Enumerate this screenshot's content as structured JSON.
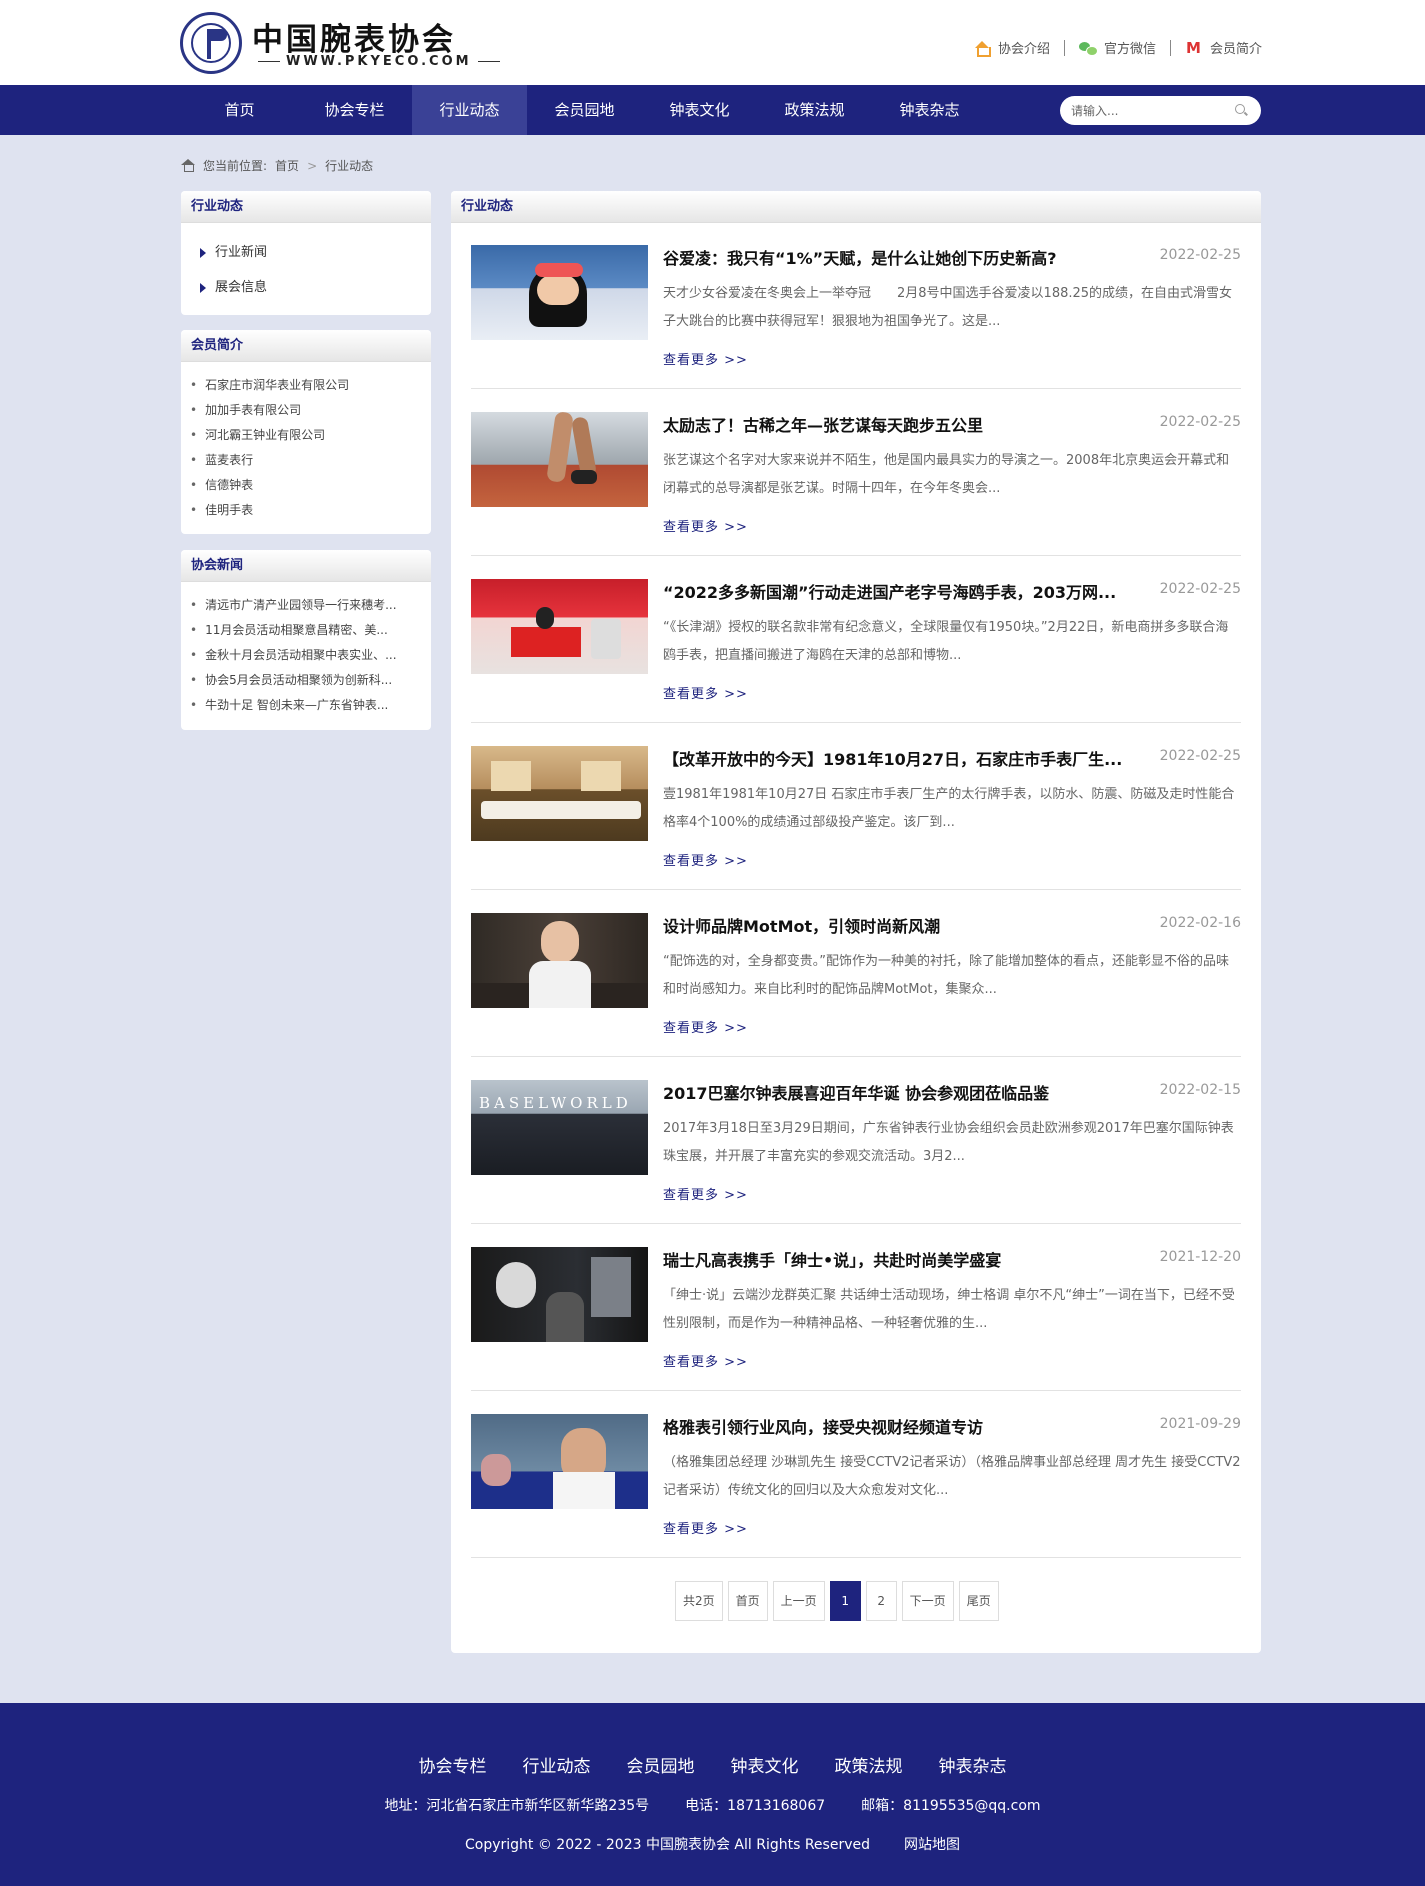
{
  "header": {
    "logo_title": "中国腕表协会",
    "logo_url": "WWW.PKYECO.COM",
    "links": [
      {
        "label": "协会介绍",
        "icon": "home-icon"
      },
      {
        "label": "官方微信",
        "icon": "wechat-icon"
      },
      {
        "label": "会员简介",
        "icon": "mail-icon"
      }
    ]
  },
  "nav": {
    "items": [
      "首页",
      "协会专栏",
      "行业动态",
      "会员园地",
      "钟表文化",
      "政策法规",
      "钟表杂志"
    ],
    "active": "行业动态",
    "search_placeholder": "请输入..."
  },
  "breadcrumb": {
    "prefix": "您当前位置:",
    "items": [
      "首页",
      "行业动态"
    ],
    "separator": ">"
  },
  "sidebar": {
    "category_panel": {
      "title": "行业动态",
      "items": [
        "行业新闻",
        "展会信息"
      ]
    },
    "members_panel": {
      "title": "会员简介",
      "items": [
        "石家庄市润华表业有限公司",
        "加加手表有限公司",
        "河北霸王钟业有限公司",
        "蓝麦表行",
        "信德钟表",
        "佳明手表"
      ]
    },
    "news_panel": {
      "title": "协会新闻",
      "items": [
        "清远市广清产业园领导一行来穗考...",
        "11月会员活动相聚意昌精密、美...",
        "金秋十月会员活动相聚中表实业、...",
        "协会5月会员活动相聚领为创新科...",
        "牛劲十足 智创未来—广东省钟表..."
      ]
    }
  },
  "main": {
    "panel_title": "行业动态",
    "more_label": "查看更多 >>",
    "articles": [
      {
        "title": "谷爱凌：我只有“1%”天赋，是什么让她创下历史新高?",
        "date": "2022-02-25",
        "summary": "天才少女谷爱凌在冬奥会上一举夺冠　　2月8号中国选手谷爱凌以188.25的成绩，在自由式滑雪女子大跳台的比赛中获得冠军！狠狠地为祖国争光了。这是..."
      },
      {
        "title": "太励志了！古稀之年—张艺谋每天跑步五公里",
        "date": "2022-02-25",
        "summary": "张艺谋这个名字对大家来说并不陌生，他是国内最具实力的导演之一。2008年北京奥运会开幕式和闭幕式的总导演都是张艺谋。时隔十四年，在今年冬奥会..."
      },
      {
        "title": "“2022多多新国潮”行动走进国产老字号海鸥手表，203万网...",
        "date": "2022-02-25",
        "summary": "“《长津湖》授权的联名款非常有纪念意义，全球限量仅有1950块。”2月22日，新电商拼多多联合海鸥手表，把直播间搬进了海鸥在天津的总部和博物..."
      },
      {
        "title": "【改革开放中的今天】1981年10月27日，石家庄市手表厂生...",
        "date": "2022-02-25",
        "summary": "壹1981年1981年10月27日 石家庄市手表厂生产的太行牌手表，以防水、防震、防磁及走时性能合格率4个100%的成绩通过部级投产鉴定。该厂到..."
      },
      {
        "title": "设计师品牌MotMot，引领时尚新风潮",
        "date": "2022-02-16",
        "summary": "“配饰选的对，全身都变贵。”配饰作为一种美的衬托，除了能增加整体的看点，还能彰显不俗的品味和时尚感知力。来自比利时的配饰品牌MotMot，集聚众..."
      },
      {
        "title": "2017巴塞尔钟表展喜迎百年华诞 协会参观团莅临品鉴",
        "date": "2022-02-15",
        "summary": "2017年3月18日至3月29日期间，广东省钟表行业协会组织会员赴欧洲参观2017年巴塞尔国际钟表珠宝展，并开展了丰富充实的参观交流活动。3月2..."
      },
      {
        "title": "瑞士凡高表携手「绅士•说」，共赴时尚美学盛宴",
        "date": "2021-12-20",
        "summary": "「绅士·说」云端沙龙群英汇聚 共话绅士活动现场，绅士格调 卓尔不凡“绅士”一词在当下，已经不受性别限制，而是作为一种精神品格、一种轻奢优雅的生..."
      },
      {
        "title": "格雅表引领行业风向，接受央视财经频道专访",
        "date": "2021-09-29",
        "summary": "（格雅集团总经理 沙琳凯先生 接受CCTV2记者采访）（格雅品牌事业部总经理 周才先生 接受CCTV2记者采访）传统文化的回归以及大众愈发对文化..."
      }
    ],
    "thumb_texts": {
      "baselworld": "BASELWORLD"
    }
  },
  "pagination": {
    "total": "共2页",
    "first": "首页",
    "prev": "上一页",
    "pages": [
      "1",
      "2"
    ],
    "current": "1",
    "next": "下一页",
    "last": "尾页"
  },
  "footer": {
    "nav": [
      "协会专栏",
      "行业动态",
      "会员园地",
      "钟表文化",
      "政策法规",
      "钟表杂志"
    ],
    "address": "地址：河北省石家庄市新华区新华路235号",
    "phone": "电话：18713168067",
    "email": "邮箱：81195535@qq.com",
    "copyright": "Copyright © 2022 - 2023 中国腕表协会 All Rights Reserved",
    "sitemap": "网站地图"
  },
  "colors": {
    "nav_bg": "#1e237e",
    "nav_active": "#3a4196",
    "page_bg": "#dfe3f0",
    "accent_home": "#f0a030",
    "wechat": "#5cb85c",
    "mail": "#dd3333"
  }
}
